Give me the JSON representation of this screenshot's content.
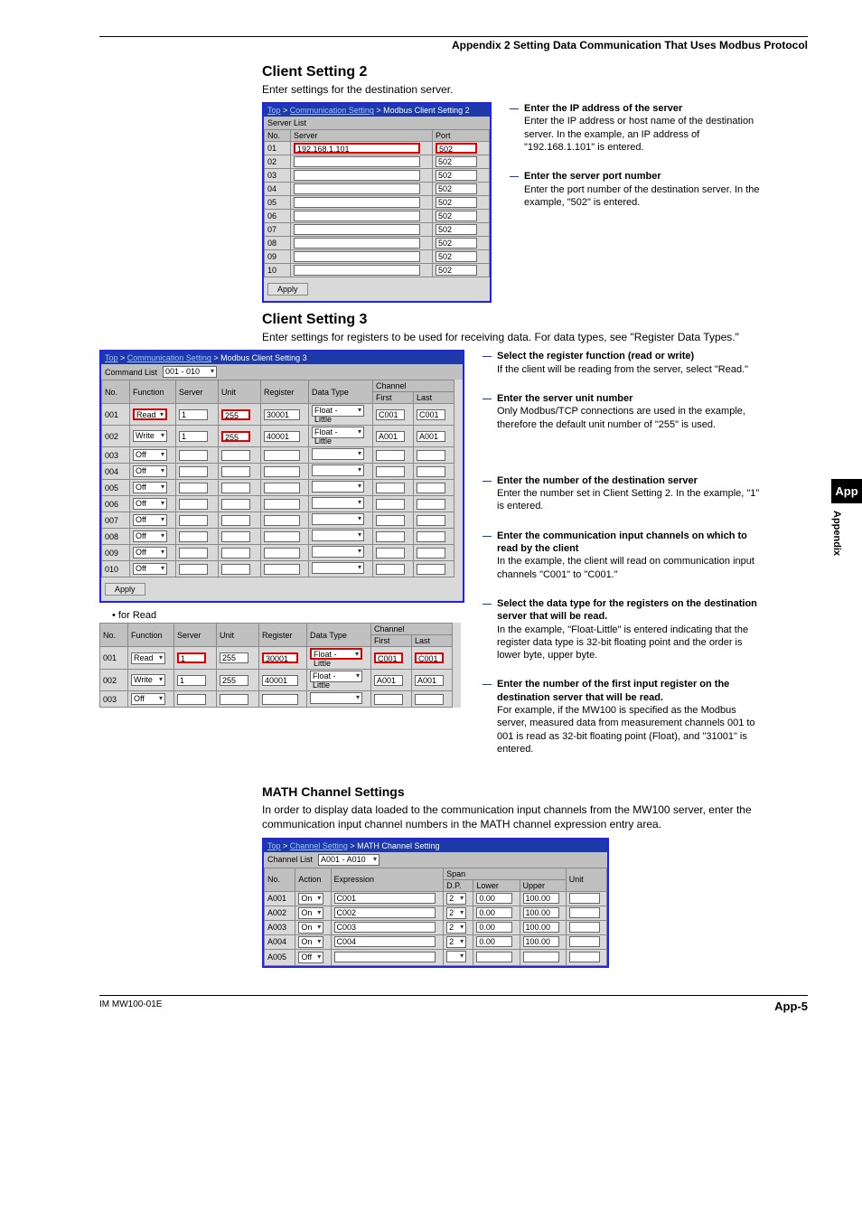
{
  "header": "Appendix 2  Setting Data Communication That Uses Modbus Protocol",
  "sideTab": {
    "app": "App",
    "appendix": "Appendix"
  },
  "footer": {
    "manual": "IM MW100-01E",
    "page": "App-5"
  },
  "cs2": {
    "title": "Client Setting 2",
    "intro": "Enter settings for the destination server.",
    "bc_top": "Top",
    "bc_mid": "Communication Setting",
    "bc_last": "Modbus Client Setting 2",
    "subbar": "Server List",
    "hdr_no": "No.",
    "hdr_server": "Server",
    "hdr_port": "Port",
    "rows": [
      {
        "no": "01",
        "server": "192.168.1.101",
        "port": "502"
      },
      {
        "no": "02",
        "server": "",
        "port": "502"
      },
      {
        "no": "03",
        "server": "",
        "port": "502"
      },
      {
        "no": "04",
        "server": "",
        "port": "502"
      },
      {
        "no": "05",
        "server": "",
        "port": "502"
      },
      {
        "no": "06",
        "server": "",
        "port": "502"
      },
      {
        "no": "07",
        "server": "",
        "port": "502"
      },
      {
        "no": "08",
        "server": "",
        "port": "502"
      },
      {
        "no": "09",
        "server": "",
        "port": "502"
      },
      {
        "no": "10",
        "server": "",
        "port": "502"
      }
    ],
    "apply": "Apply",
    "co1_t": "Enter the IP address of the server",
    "co1_b": "Enter the IP address or host name of the destination server. In the example, an IP address of \"192.168.1.101\" is entered.",
    "co2_t": "Enter the server port number",
    "co2_b": "Enter the port number of the destination server. In the example, \"502\" is entered."
  },
  "cs3": {
    "title": "Client Setting 3",
    "intro": "Enter settings for registers to be used for receiving data. For data types, see \"Register Data Types.\"",
    "bc_top": "Top",
    "bc_mid": "Communication Setting",
    "bc_last": "Modbus Client Setting 3",
    "subbar": "Command List",
    "range": "001 - 010",
    "hdr_no": "No.",
    "hdr_func": "Function",
    "hdr_server": "Server",
    "hdr_unit": "Unit",
    "hdr_reg": "Register",
    "hdr_dtype": "Data Type",
    "hdr_ch": "Channel",
    "hdr_first": "First",
    "hdr_last": "Last",
    "rows": [
      {
        "no": "001",
        "func": "Read",
        "server": "1",
        "unit": "255",
        "reg": "30001",
        "dtype": "Float - Little",
        "first": "C001",
        "last": "C001"
      },
      {
        "no": "002",
        "func": "Write",
        "server": "1",
        "unit": "255",
        "reg": "40001",
        "dtype": "Float - Little",
        "first": "A001",
        "last": "A001"
      },
      {
        "no": "003",
        "func": "Off"
      },
      {
        "no": "004",
        "func": "Off"
      },
      {
        "no": "005",
        "func": "Off"
      },
      {
        "no": "006",
        "func": "Off"
      },
      {
        "no": "007",
        "func": "Off"
      },
      {
        "no": "008",
        "func": "Off"
      },
      {
        "no": "009",
        "func": "Off"
      },
      {
        "no": "010",
        "func": "Off"
      }
    ],
    "apply": "Apply",
    "for_read": "for Read",
    "read_rows": [
      {
        "no": "001",
        "func": "Read",
        "server": "1",
        "unit": "255",
        "reg": "30001",
        "dtype": "Float - Little",
        "first": "C001",
        "last": "C001"
      },
      {
        "no": "002",
        "func": "Write",
        "server": "1",
        "unit": "255",
        "reg": "40001",
        "dtype": "Float - Little",
        "first": "A001",
        "last": "A001"
      },
      {
        "no": "003",
        "func": "Off"
      }
    ],
    "co1_t": "Select the register function (read or write)",
    "co1_b": "If the client will be reading from the server, select \"Read.\"",
    "co2_t": "Enter the server unit number",
    "co2_b": "Only Modbus/TCP connections are used in the example, therefore the default unit number of \"255\" is used.",
    "co3_t": "Enter the number of the destination server",
    "co3_b": "Enter the number set in Client Setting 2. In the example, \"1\" is entered.",
    "co4_t": "Enter the communication input channels on which to read by the client",
    "co4_b": "In the example, the client will read on communication input channels \"C001\" to \"C001.\"",
    "co5_t": "Select the data type for the registers on the destination server that will be read.",
    "co5_b": "In the example, \"Float-Little\" is entered indicating that the register data type is 32-bit floating point and the order is lower byte, upper byte.",
    "co6_t": "Enter the number of the first input register on the destination server that will be read.",
    "co6_b": "For example, if the MW100 is specified as the Modbus server, measured data from measurement channels 001 to 001 is read as 32-bit floating point (Float), and \"31001\" is entered."
  },
  "math": {
    "title": "MATH Channel Settings",
    "intro": "In order to display data loaded to the communication input channels from the MW100 server, enter the communication input channel numbers in the MATH channel expression entry area.",
    "bc_top": "Top",
    "bc_mid": "Channel Setting",
    "bc_last": "MATH Channel Setting",
    "subbar": "Channel List",
    "range": "A001 - A010",
    "hdr_no": "No.",
    "hdr_action": "Action",
    "hdr_expr": "Expression",
    "hdr_span": "Span",
    "hdr_dp": "D.P.",
    "hdr_lower": "Lower",
    "hdr_upper": "Upper",
    "hdr_unit": "Unit",
    "rows": [
      {
        "no": "A001",
        "action": "On",
        "expr": "C001",
        "dp": "2",
        "lower": "0.00",
        "upper": "100.00",
        "unit": ""
      },
      {
        "no": "A002",
        "action": "On",
        "expr": "C002",
        "dp": "2",
        "lower": "0.00",
        "upper": "100.00",
        "unit": ""
      },
      {
        "no": "A003",
        "action": "On",
        "expr": "C003",
        "dp": "2",
        "lower": "0.00",
        "upper": "100.00",
        "unit": ""
      },
      {
        "no": "A004",
        "action": "On",
        "expr": "C004",
        "dp": "2",
        "lower": "0.00",
        "upper": "100.00",
        "unit": ""
      },
      {
        "no": "A005",
        "action": "Off",
        "expr": "",
        "dp": "",
        "lower": "",
        "upper": "",
        "unit": ""
      }
    ]
  }
}
